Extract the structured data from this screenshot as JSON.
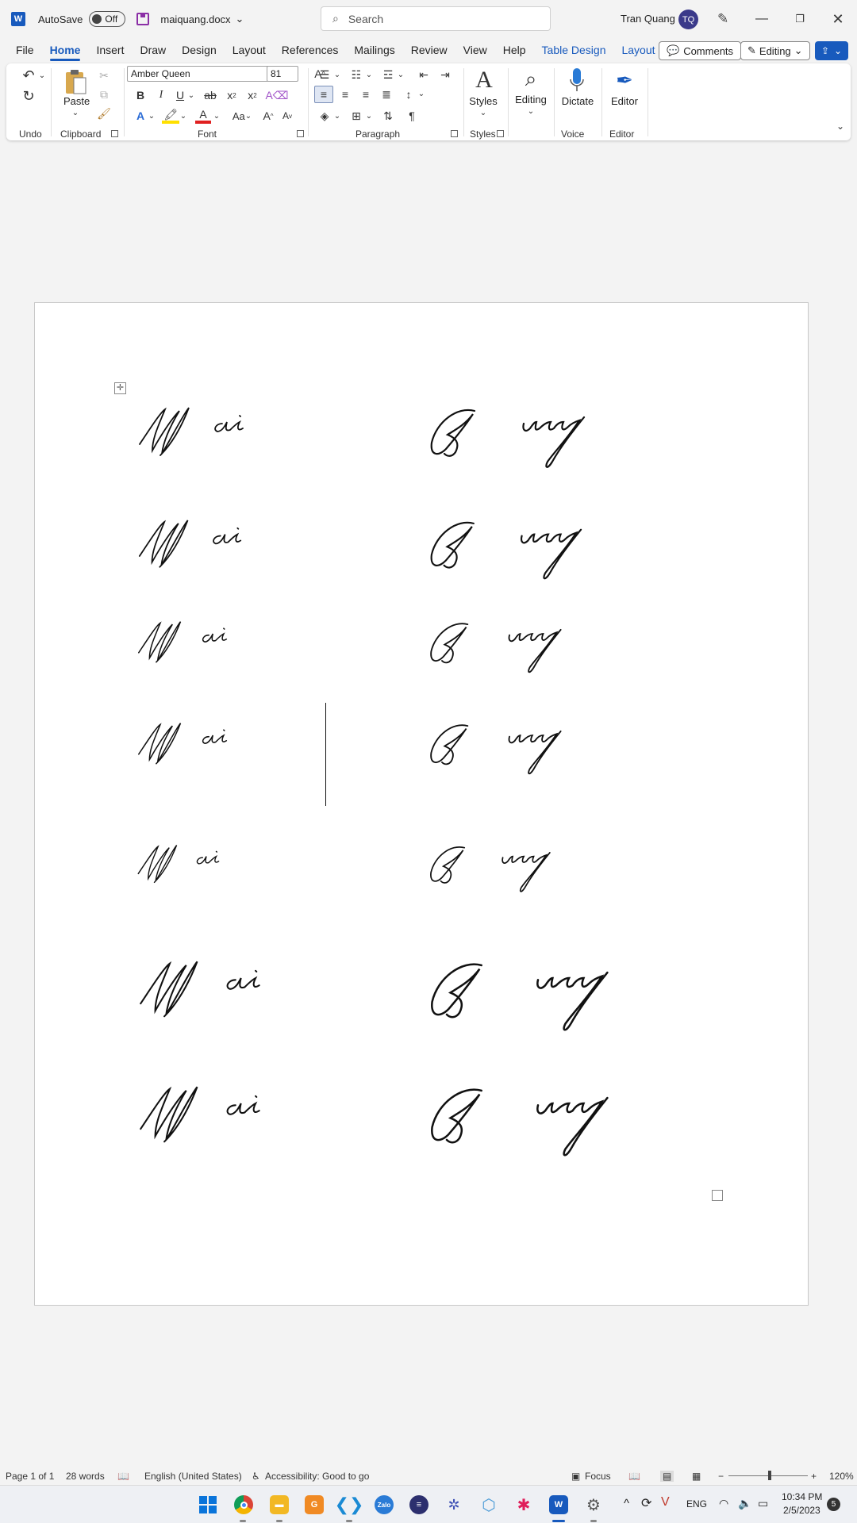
{
  "titlebar": {
    "autosave_label": "AutoSave",
    "autosave_state": "Off",
    "document_name": "maiquang.docx",
    "search_placeholder": "Search",
    "user_name": "Tran Quang",
    "user_initials": "TQ"
  },
  "menu": {
    "tabs": [
      "File",
      "Home",
      "Insert",
      "Draw",
      "Design",
      "Layout",
      "References",
      "Mailings",
      "Review",
      "View",
      "Help",
      "Table Design",
      "Layout"
    ],
    "active_tab": "Home",
    "comments_label": "Comments",
    "editing_label": "Editing"
  },
  "ribbon": {
    "font_name": "Amber Queen",
    "font_size": "81",
    "groups": {
      "undo": "Undo",
      "clipboard": "Clipboard",
      "font": "Font",
      "paragraph": "Paragraph",
      "styles": "Styles",
      "voice": "Voice",
      "editor": "Editor"
    },
    "buttons": {
      "paste": "Paste",
      "styles": "Styles",
      "editing": "Editing",
      "dictate": "Dictate",
      "editor": "Editor",
      "bold": "B",
      "italic": "I",
      "underline": "U",
      "strikethrough": "ab",
      "subscript": "x",
      "superscript": "x",
      "change_case": "Aa",
      "grow_font": "A",
      "shrink_font": "A",
      "pilcrow": "¶"
    }
  },
  "document": {
    "rows": 7,
    "left_signature": "Mai",
    "right_signature": "Quang"
  },
  "statusbar": {
    "page": "Page 1 of 1",
    "words": "28 words",
    "language": "English (United States)",
    "accessibility": "Accessibility: Good to go",
    "focus": "Focus",
    "zoom": "120%"
  },
  "taskbar": {
    "language": "ENG",
    "time": "10:34 PM",
    "date": "2/5/2023",
    "notification_count": "5"
  },
  "colors": {
    "accent": "#185abd",
    "avatar": "#3b3a8a",
    "save_icon": "#8b2fa6"
  }
}
